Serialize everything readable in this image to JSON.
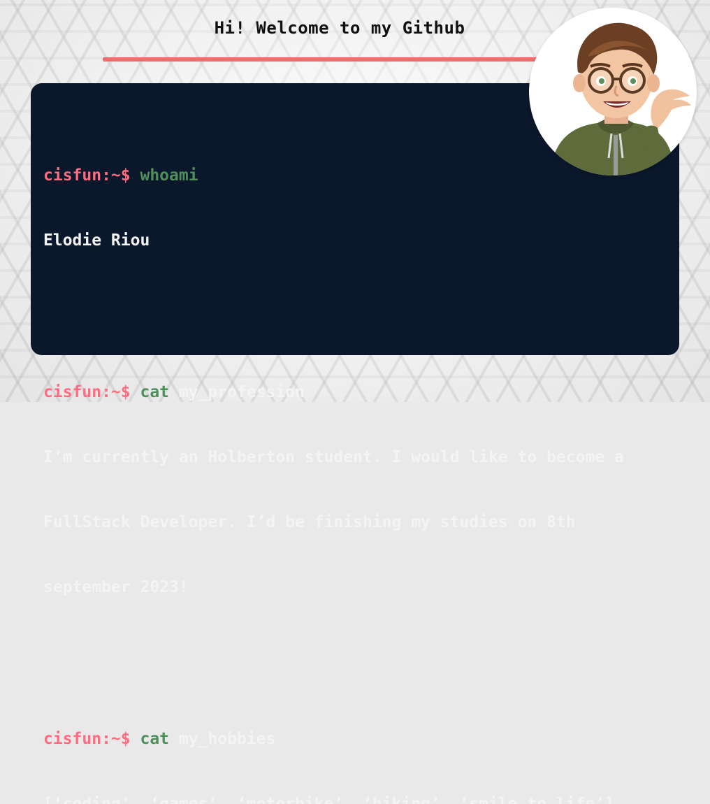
{
  "header": {
    "title": "Hi! Welcome to my Github"
  },
  "terminal": {
    "prompt": "cisfun:~$",
    "blocks": [
      {
        "command": "whoami",
        "argument": "",
        "output": [
          "Elodie Riou"
        ]
      },
      {
        "command": "cat",
        "argument": "my_profession",
        "output": [
          "I’m currently an Holberton student. I would like to become a",
          "FullStack Developer. I’d be finishing my studies on 8th",
          "september 2023!"
        ]
      },
      {
        "command": "cat",
        "argument": "my_hobbies",
        "output": [
          "[‘coding’, ‘games’, ‘motorbike’, ‘hiking’, ‘smile to life’]"
        ]
      }
    ]
  },
  "avatar": {
    "icon": "memoji-avatar-icon"
  },
  "colors": {
    "terminal_bg": "#0b172a",
    "prompt": "#ff6b7f",
    "command": "#4f8f5a",
    "text": "#f4f4f4",
    "accent_line": "#f46b6b"
  }
}
